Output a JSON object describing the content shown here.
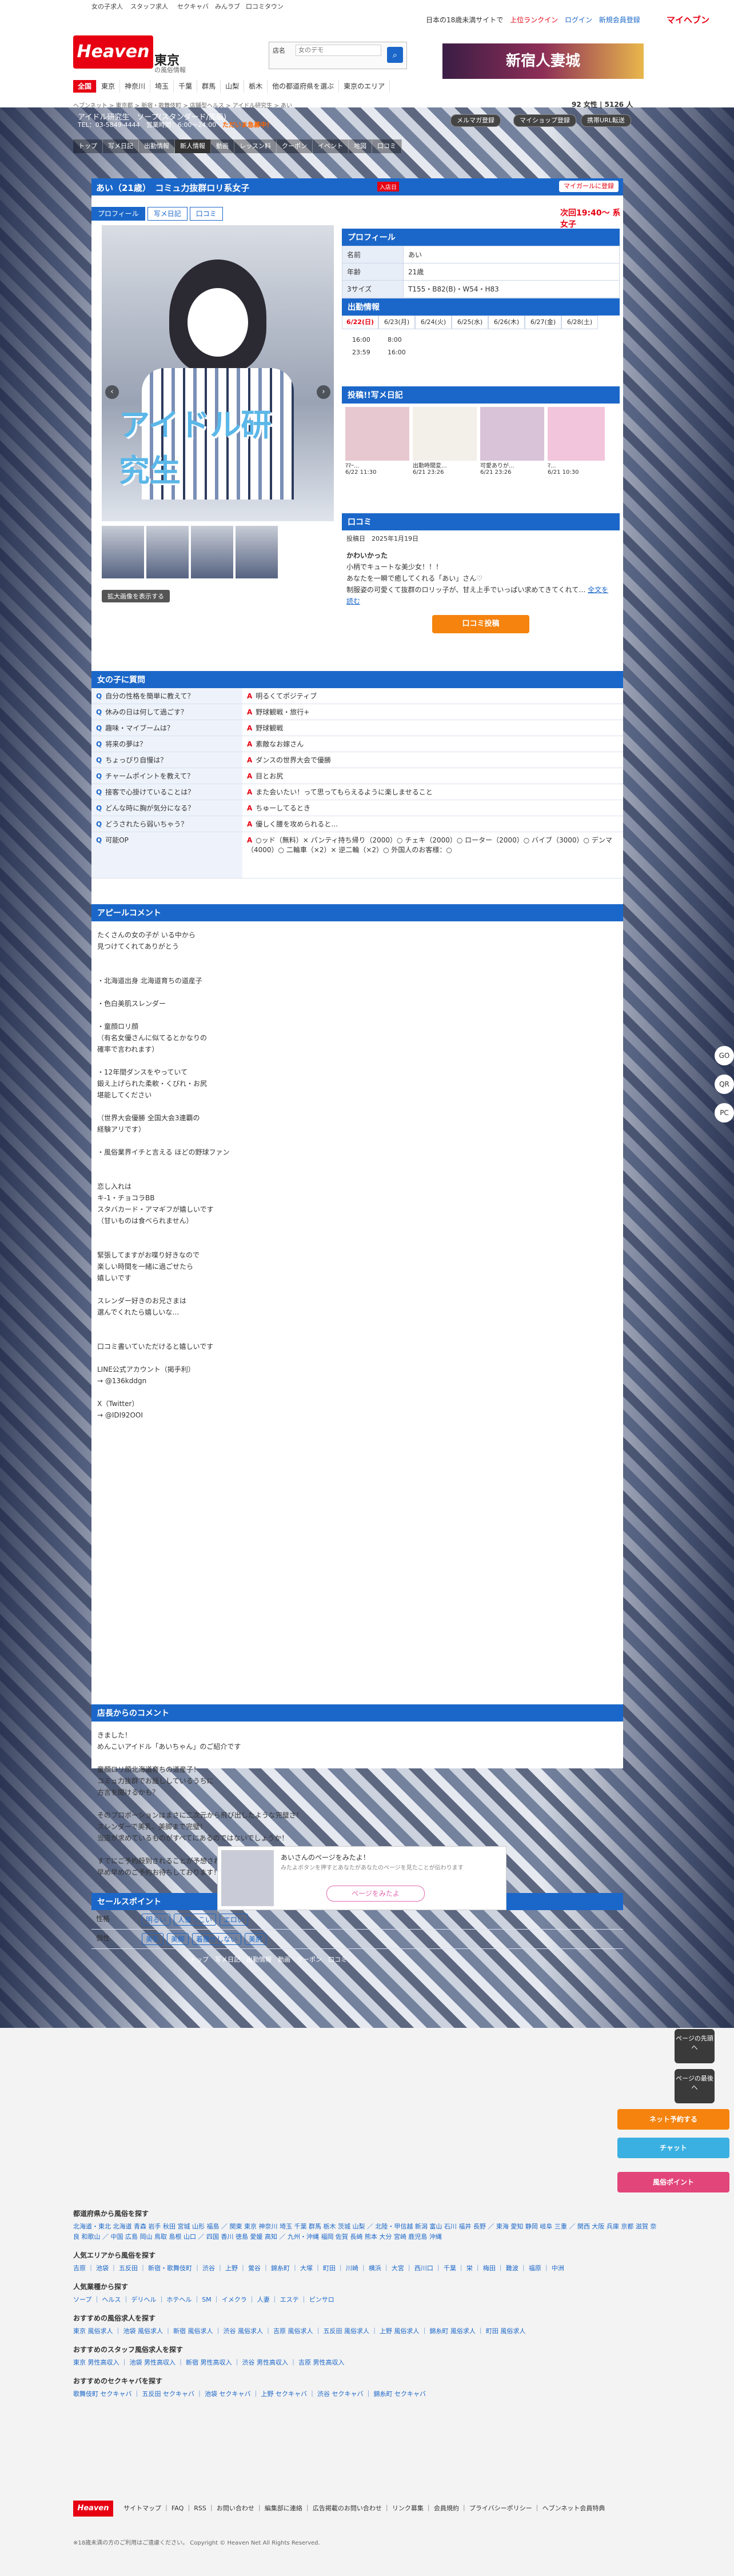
{
  "top": {
    "strip": [
      "女の子求人",
      "スタッフ求人",
      "セクキャバ",
      "みんラブ",
      "口コミタウン"
    ],
    "links": [
      "日本の18歳未満サイトで",
      "上位ランクイン",
      "ログイン",
      "新規会員登録"
    ],
    "mypage": "マイヘブン"
  },
  "header": {
    "logo": "Heaven",
    "area": "東京",
    "area_sub": "の風俗情報",
    "search_label": "店名",
    "search_placeholder": "女のデモ",
    "banner": "新宿人妻城"
  },
  "gnav": [
    "全国",
    "東京",
    "神奈川",
    "埼玉",
    "千葉",
    "群馬",
    "山梨",
    "栃木",
    "他の都道府県を選ぶ",
    "東京のエリア"
  ],
  "crumb": "ヘブンネット > 東京都 > 新宿・歌舞伎町 > 店舗型ヘルス > アイドル研究生 > あい",
  "crumb_count": "92 女性 | 5126 人",
  "shop": {
    "name": "アイドル研究生",
    "genre": "ソープ(スタンダード/高級)",
    "tel": "TEL：03-5849-4444",
    "hours": "営業時間：6:00～24:00",
    "hot": "ただいま急募中！",
    "buttons": [
      "メルマガ登録",
      "マイショップ登録",
      "携帯URL転送"
    ],
    "nav": [
      "トップ",
      "写メ日記",
      "出勤情報",
      "新人情報",
      "動画",
      "レッスン料",
      "クーポン",
      "イベント",
      "地図",
      "口コミ"
    ]
  },
  "girl": {
    "name": "あい（21歳）",
    "catch": "コミュ力抜群ロリ系女子",
    "new": "入店日",
    "fav": "マイガールに登録",
    "tabs": [
      "プロフィール",
      "写メ日記",
      "口コミ"
    ],
    "next_work": "次回19:40～ 系女子",
    "photo_logo": "アイドル研究生",
    "thumb_btn": "拡大画像を表示する"
  },
  "profile": {
    "title": "プロフィール",
    "rows": [
      {
        "k": "名前",
        "v": "あい"
      },
      {
        "k": "年齢",
        "v": "21歳"
      },
      {
        "k": "3サイズ",
        "v": "T155・B82(B)・W54・H83"
      }
    ]
  },
  "schedule": {
    "title": "出勤情報",
    "days": [
      "6/22(日)",
      "6/23(月)",
      "6/24(火)",
      "6/25(水)",
      "6/26(木)",
      "6/27(金)",
      "6/28(土)"
    ],
    "time1": [
      "16:00",
      "8:00"
    ],
    "time2": [
      "23:59",
      "16:00"
    ]
  },
  "diary": {
    "title": "投稿!!写メ日記",
    "items": [
      {
        "t": "ﾏﾏｰ...",
        "d": "6/22 11:30"
      },
      {
        "t": "出勤時間変...",
        "d": "6/21 23:26"
      },
      {
        "t": "可愛ありが...",
        "d": "6/21 23:26"
      },
      {
        "t": "ﾏ...",
        "d": "6/21 10:30"
      }
    ]
  },
  "review": {
    "title": "口コミ",
    "date_label": "投稿日",
    "date": "2025年1月19日",
    "head": "かわいかった",
    "body": "小柄でキュートな美少女！！！\nあなたを一瞬で癒してくれる「あい」さん♡\n制服姿の可愛くて抜群のロリッ子が、甘え上手でいっぱい求めてきてくれて…",
    "more": "全文を読む",
    "btn": "口コミ投稿"
  },
  "qa": {
    "title": "女の子に質問",
    "rows": [
      {
        "q": "自分の性格を簡単に教えて？",
        "a": "明るくてポジティブ"
      },
      {
        "q": "休みの日は何して過ごす？",
        "a": "野球観戦・旅行+"
      },
      {
        "q": "趣味・マイブームは？",
        "a": "野球観戦"
      },
      {
        "q": "将来の夢は？",
        "a": "素敵なお嫁さん"
      },
      {
        "q": "ちょっぴり自慢は？",
        "a": "ダンスの世界大会で優勝"
      },
      {
        "q": "チャームポイントを教えて？",
        "a": "目とお尻"
      },
      {
        "q": "接客で心掛けていることは？",
        "a": "また会いたい！って思ってもらえるように楽しませること"
      },
      {
        "q": "どんな時に胸が気分になる？",
        "a": "ちゅーしてるとき"
      },
      {
        "q": "どうされたら弱いちゃう？",
        "a": "優しく腰を攻められると…"
      },
      {
        "q": "可能OP",
        "a": "○ッド（無料）× パンティ持ち帰り（2000）○ チェキ（2000）○ ローター（2000）○ バイブ（3000）○ デンマ（4000）○ 二輪車（×2）× 逆二輪（×2）○ 外国人のお客様：○"
      }
    ]
  },
  "appeal": {
    "title": "アピールコメント",
    "body": "たくさんの女の子が いる中から\n見つけてくれてありがとう\n\n\n・北海道出身 北海道育ちの道産子\n\n・色白美肌スレンダー\n\n・童顔ロリ顔\n（有名女優さんに似てるとかなりの\n確率で言われます）\n\n・12年間ダンスをやっていて\n鍛え上げられた柔軟・くびれ・お尻\n堪能してください\n\n（世界大会優勝 全国大会3連覇の\n経験アリです）\n\n・風俗業界イチと言える ほどの野球ファン\n\n\n恋し入れは\nキ-1・チョコラBB\nスタバカード・アマギフが嬉しいです\n（甘いものは食べられません）\n\n\n緊張してますがお喋り好きなので\n楽しい時間を一緒に過ごせたら\n嬉しいです\n\nスレンダー好きのお兄さまは\n選んでくれたら嬉しいな…\n\n\n口コミ書いていただけると嬉しいです\n\nLINE公式アカウント（掲手利）\n→ @136kddgn\n\nX（Twitter）\n→ @IDI92OOI"
  },
  "staff": {
    "title": "店長からのコメント",
    "body": "きました！\nめんこいアイドル「あいちゃん」のご紹介です\n\n童顔ロリ顔北海道育ちの道産子！\nコミュ力抜群でお話ししているうちに\n方言を聞けるかも？\n\nそのプロポーションはまさに二次元から飛び出したような完璧さ！\nスレンダーで美乳、美脚まで完璧！\n当店が求めているものがすべてにあるのではないでしょうか！\n\nすでにご予約殺到されることが予想されます。\n早め早めのご予約お待ちしております！"
  },
  "sales": {
    "title": "セールスポイント",
    "rows": [
      {
        "k": "性格",
        "tags": [
          "明るい",
          "人懐っこい",
          "エロい"
        ]
      },
      {
        "k": "個性",
        "tags": [
          "美乳",
          "美脚",
          "着痩せしない",
          "美尻"
        ]
      }
    ]
  },
  "mini": {
    "title": "あいさんのページをみたよ！",
    "sub": "みたよボタンを押すとあなたがあなたのページを見たことが伝わります",
    "btn": "ページをみたよ"
  },
  "footnav": "トップ　写メ日記　出勤情報　動画　クーポン　口コミ",
  "side": [
    "GO",
    "QR",
    "PC"
  ],
  "floats": [
    {
      "label": "ネット予約する",
      "color": "#f5830e"
    },
    {
      "label": "チャット",
      "color": "#3ab0e2"
    },
    {
      "label": "風俗ポイント",
      "color": "#e2457a"
    }
  ],
  "pagebtns": [
    "ページの先頭へ",
    "ページの最後へ"
  ],
  "footer": {
    "s1": "都道府県から風俗を探す",
    "l1": "北海道・東北 北海道 青森 岩手 秋田 宮城 山形 福島 ／ 関東 東京 神奈川 埼玉 千葉 群馬 栃木 茨城 山梨 ／ 北陸・甲信越 新潟 富山 石川 福井 長野 ／ 東海 愛知 静岡 岐阜 三重 ／ 関西 大阪 兵庫 京都 滋賀 奈良 和歌山 ／ 中国 広島 岡山 鳥取 島根 山口 ／ 四国 香川 徳島 愛媛 高知 ／ 九州・沖縄 福岡 佐賀 長崎 熊本 大分 宮崎 鹿児島 沖縄",
    "s2": "人気エリアから風俗を探す",
    "l2": "吉原 ｜ 池袋 ｜ 五反田 ｜ 新宿・歌舞伎町 ｜ 渋谷 ｜ 上野 ｜ 鶯谷 ｜ 錦糸町 ｜ 大塚 ｜ 町田 ｜ 川崎 ｜ 横浜 ｜ 大宮 ｜ 西川口 ｜ 千葉 ｜ 栄 ｜ 梅田 ｜ 難波 ｜ 福原 ｜ 中洲",
    "s3": "人気業種から探す",
    "l3": "ソープ ｜ ヘルス ｜ デリヘル ｜ ホテヘル ｜ SM ｜ イメクラ ｜ 人妻 ｜ エステ ｜ ピンサロ",
    "s4": "おすすめの風俗求人を探す",
    "l4": "東京 風俗求人 ｜ 池袋 風俗求人 ｜ 新宿 風俗求人 ｜ 渋谷 風俗求人 ｜ 吉原 風俗求人 ｜ 五反田 風俗求人 ｜ 上野 風俗求人 ｜ 錦糸町 風俗求人 ｜ 町田 風俗求人",
    "s5": "おすすめのスタッフ風俗求人を探す",
    "l5": "東京 男性高収入 ｜ 池袋 男性高収入 ｜ 新宿 男性高収入 ｜ 渋谷 男性高収入 ｜ 吉原 男性高収入",
    "s6": "おすすめのセクキャバを探す",
    "l6": "歌舞伎町 セクキャバ ｜ 五反田 セクキャバ ｜ 池袋 セクキャバ ｜ 上野 セクキャバ ｜ 渋谷 セクキャバ ｜ 錦糸町 セクキャバ",
    "links": "サイトマップ ｜ FAQ ｜ RSS ｜ お問い合わせ ｜ 編集部に連絡 ｜ 広告掲載のお問い合わせ ｜ リンク募集 ｜ 会員規約 ｜ プライバシーポリシー ｜ ヘブンネット会員特典",
    "copy": "※18歳未満の方のご利用はご遠慮ください。 Copyright © Heaven Net All Rights Reserved."
  }
}
